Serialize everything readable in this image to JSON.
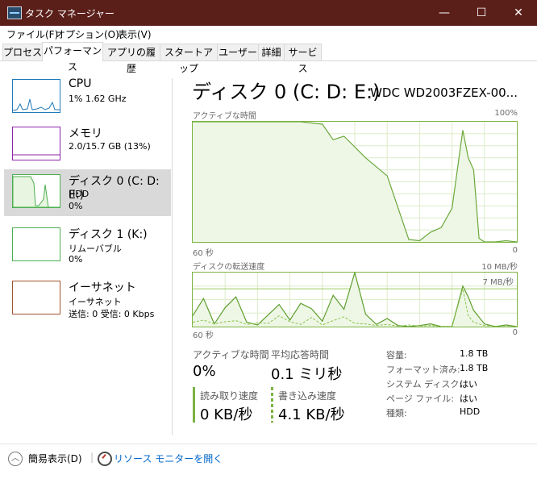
{
  "window": {
    "title": "タスク マネージャー",
    "minimize": "—",
    "maximize": "☐",
    "close": "✕"
  },
  "menu": [
    "ファイル(F)",
    "オプション(O)",
    "表示(V)"
  ],
  "tabs": [
    "プロセス",
    "パフォーマンス",
    "アプリの履歴",
    "スタートアップ",
    "ユーザー",
    "詳細",
    "サービス"
  ],
  "active_tab": "パフォーマンス",
  "sidebar": {
    "items": [
      {
        "title": "CPU",
        "line2": "1%  1.62 GHz",
        "line3": "",
        "color": "#1e7ab8"
      },
      {
        "title": "メモリ",
        "line2": "2.0/15.7 GB (13%)",
        "line3": "",
        "color": "#8e24aa"
      },
      {
        "title": "ディスク 0 (C: D: E:)",
        "line2": "HDD",
        "line3": "0%",
        "color": "#4caf50"
      },
      {
        "title": "ディスク 1 (K:)",
        "line2": "リムーバブル",
        "line3": "0%",
        "color": "#4caf50"
      },
      {
        "title": "イーサネット",
        "line2": "イーサネット",
        "line3": "送信: 0 受信: 0 Kbps",
        "color": "#a0522d"
      }
    ]
  },
  "main": {
    "heading": "ディスク 0 (C: D: E:)",
    "model": "WDC WD2003FZEX-00...",
    "graph1": {
      "label": "アクティブな時間",
      "max": "100%",
      "xleft": "60 秒",
      "xright": "0"
    },
    "graph2": {
      "label": "ディスクの転送速度",
      "max": "10 MB/秒",
      "marker": "7 MB/秒",
      "xleft": "60 秒",
      "xright": "0"
    },
    "stats": {
      "active_time_label": "アクティブな時間",
      "active_time_value": "0%",
      "response_label": "平均応答時間",
      "response_value": "0.1 ミリ秒",
      "read_label": "読み取り速度",
      "read_value": "0 KB/秒",
      "write_label": "書き込み速度",
      "write_value": "4.1 KB/秒"
    },
    "properties": [
      {
        "label": "容量:",
        "value": "1.8 TB"
      },
      {
        "label": "フォーマット済み:",
        "value": "1.8 TB"
      },
      {
        "label": "システム ディスク:",
        "value": "はい"
      },
      {
        "label": "ページ ファイル:",
        "value": "はい"
      },
      {
        "label": "種類:",
        "value": "HDD"
      }
    ]
  },
  "footer": {
    "fewer_details": "簡易表示(D)",
    "resource_monitor": "リソース モニターを開く"
  },
  "colors": {
    "titlebar": "#5b1f1a",
    "disk_green": "#7cb342",
    "link_blue": "#0066cc"
  },
  "chart_data": [
    {
      "type": "area",
      "title": "アクティブな時間",
      "ylabel": "%",
      "ylim": [
        0,
        100
      ],
      "x": [
        60,
        56,
        52,
        48,
        44,
        40,
        36,
        34,
        32,
        28,
        24,
        20,
        18,
        16,
        14,
        12,
        10,
        9,
        8,
        7,
        6,
        4,
        2,
        0
      ],
      "series": [
        {
          "values": [
            100,
            100,
            100,
            100,
            100,
            100,
            98,
            85,
            88,
            70,
            55,
            2,
            1,
            8,
            12,
            28,
            93,
            70,
            60,
            3,
            0,
            0,
            1,
            0
          ]
        }
      ]
    },
    {
      "type": "line",
      "title": "ディスクの転送速度",
      "ylabel": "MB/秒",
      "ylim": [
        0,
        10
      ],
      "x": [
        60,
        58,
        56,
        54,
        52,
        50,
        48,
        46,
        44,
        42,
        40,
        38,
        36,
        34,
        32,
        30,
        28,
        26,
        24,
        22,
        20,
        18,
        16,
        14,
        12,
        10,
        9,
        8,
        6,
        4,
        2,
        0
      ],
      "series": [
        {
          "values": [
            2,
            5.2,
            0.5,
            3.5,
            5.5,
            0.8,
            0.3,
            2.2,
            4.1,
            1.2,
            4.3,
            3.3,
            1.0,
            5.8,
            3.2,
            10.0,
            2.3,
            0.4,
            1.5,
            0.2,
            0,
            0.2,
            0.5,
            0,
            0,
            7.5,
            5.5,
            3.0,
            0.5,
            0,
            0.3,
            0
          ]
        },
        {
          "values": [
            0.8,
            1.2,
            0.5,
            0.9,
            1.1,
            0.4,
            0.7,
            0.6,
            2.0,
            0.9,
            0.4,
            1.7,
            0.3,
            1.1,
            1.8,
            0.6,
            0.5,
            0.2,
            0.4,
            0.1,
            0.3,
            0.1,
            0.2,
            0,
            0,
            7.0,
            2.0,
            0.8,
            0.2,
            0.1,
            0,
            0
          ]
        }
      ]
    }
  ]
}
